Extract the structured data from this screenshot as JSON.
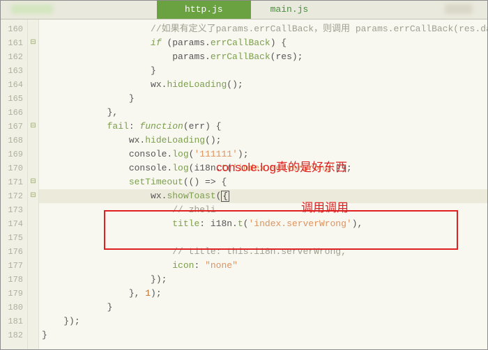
{
  "tabs": {
    "active": "http.js",
    "inactive": "main.js"
  },
  "line_start": 160,
  "fold_marks": {
    "161": "⊟",
    "167": "⊟",
    "171": "⊟",
    "172": "⊟"
  },
  "lines": [
    {
      "ind": 20,
      "seg": [
        {
          "t": "//如果有定义了params.errCallBack，则调用 params.errCallBack(res.da",
          "c": "c-comment"
        }
      ]
    },
    {
      "ind": 20,
      "seg": [
        {
          "t": "if",
          "c": "c-keyword"
        },
        {
          "t": " (params.",
          "c": "c-txt"
        },
        {
          "t": "errCallBack",
          "c": "c-key"
        },
        {
          "t": ") {",
          "c": "c-txt"
        }
      ]
    },
    {
      "ind": 24,
      "seg": [
        {
          "t": "params.",
          "c": "c-txt"
        },
        {
          "t": "errCallBack",
          "c": "c-key"
        },
        {
          "t": "(res);",
          "c": "c-txt"
        }
      ]
    },
    {
      "ind": 20,
      "seg": [
        {
          "t": "}",
          "c": "c-txt"
        }
      ]
    },
    {
      "ind": 20,
      "seg": [
        {
          "t": "wx.",
          "c": "c-txt"
        },
        {
          "t": "hideLoading",
          "c": "c-key"
        },
        {
          "t": "();",
          "c": "c-txt"
        }
      ]
    },
    {
      "ind": 16,
      "seg": [
        {
          "t": "}",
          "c": "c-txt"
        }
      ]
    },
    {
      "ind": 12,
      "seg": [
        {
          "t": "},",
          "c": "c-txt"
        }
      ]
    },
    {
      "ind": 12,
      "seg": [
        {
          "t": "fail",
          "c": "c-key"
        },
        {
          "t": ": ",
          "c": "c-txt"
        },
        {
          "t": "function",
          "c": "c-keyword"
        },
        {
          "t": "(err) {",
          "c": "c-txt"
        }
      ]
    },
    {
      "ind": 16,
      "seg": [
        {
          "t": "wx.",
          "c": "c-txt"
        },
        {
          "t": "hideLoading",
          "c": "c-key"
        },
        {
          "t": "();",
          "c": "c-txt"
        }
      ]
    },
    {
      "ind": 16,
      "seg": [
        {
          "t": "console.",
          "c": "c-txt"
        },
        {
          "t": "log",
          "c": "c-key"
        },
        {
          "t": "(",
          "c": "c-txt"
        },
        {
          "t": "'111111'",
          "c": "c-str"
        },
        {
          "t": ");",
          "c": "c-txt"
        }
      ]
    },
    {
      "ind": 16,
      "seg": [
        {
          "t": "console.",
          "c": "c-txt"
        },
        {
          "t": "log",
          "c": "c-key"
        },
        {
          "t": "(i18n.",
          "c": "c-txt"
        },
        {
          "t": "t",
          "c": "c-key"
        },
        {
          "t": "(",
          "c": "c-txt"
        },
        {
          "t": "'index.serverWrong'",
          "c": "c-str"
        },
        {
          "t": "));",
          "c": "c-txt"
        }
      ]
    },
    {
      "ind": 16,
      "seg": [
        {
          "t": "setTimeout",
          "c": "c-key"
        },
        {
          "t": "(() => {",
          "c": "c-txt"
        }
      ]
    },
    {
      "ind": 20,
      "cursor": true,
      "seg": [
        {
          "t": "wx.",
          "c": "c-txt"
        },
        {
          "t": "showToast",
          "c": "c-key"
        },
        {
          "t": "(",
          "c": "c-txt"
        },
        {
          "t": "{",
          "c": "caret-box"
        }
      ]
    },
    {
      "ind": 24,
      "seg": [
        {
          "t": "// zheli",
          "c": "c-comment"
        }
      ]
    },
    {
      "ind": 24,
      "seg": [
        {
          "t": "title",
          "c": "c-key"
        },
        {
          "t": ": i18n.",
          "c": "c-txt"
        },
        {
          "t": "t",
          "c": "c-key"
        },
        {
          "t": "(",
          "c": "c-txt"
        },
        {
          "t": "'index.serverWrong'",
          "c": "c-str"
        },
        {
          "t": "),",
          "c": "c-txt"
        }
      ]
    },
    {
      "ind": 0,
      "seg": []
    },
    {
      "ind": 24,
      "seg": [
        {
          "t": "// title: this.i18n.serverWrong,",
          "c": "c-comment"
        }
      ]
    },
    {
      "ind": 24,
      "seg": [
        {
          "t": "icon",
          "c": "c-key"
        },
        {
          "t": ": ",
          "c": "c-txt"
        },
        {
          "t": "\"none\"",
          "c": "c-str"
        }
      ]
    },
    {
      "ind": 20,
      "seg": [
        {
          "t": "});",
          "c": "c-txt"
        }
      ]
    },
    {
      "ind": 16,
      "seg": [
        {
          "t": "}, ",
          "c": "c-txt"
        },
        {
          "t": "1",
          "c": "c-num"
        },
        {
          "t": ");",
          "c": "c-txt"
        }
      ]
    },
    {
      "ind": 12,
      "seg": [
        {
          "t": "}",
          "c": "c-txt"
        }
      ]
    },
    {
      "ind": 4,
      "seg": [
        {
          "t": "});",
          "c": "c-txt"
        }
      ]
    },
    {
      "ind": 0,
      "seg": [
        {
          "t": "}",
          "c": "c-txt"
        }
      ]
    }
  ],
  "annotations": {
    "a1": "console.log真的是好东西",
    "a2": "调用调用"
  }
}
